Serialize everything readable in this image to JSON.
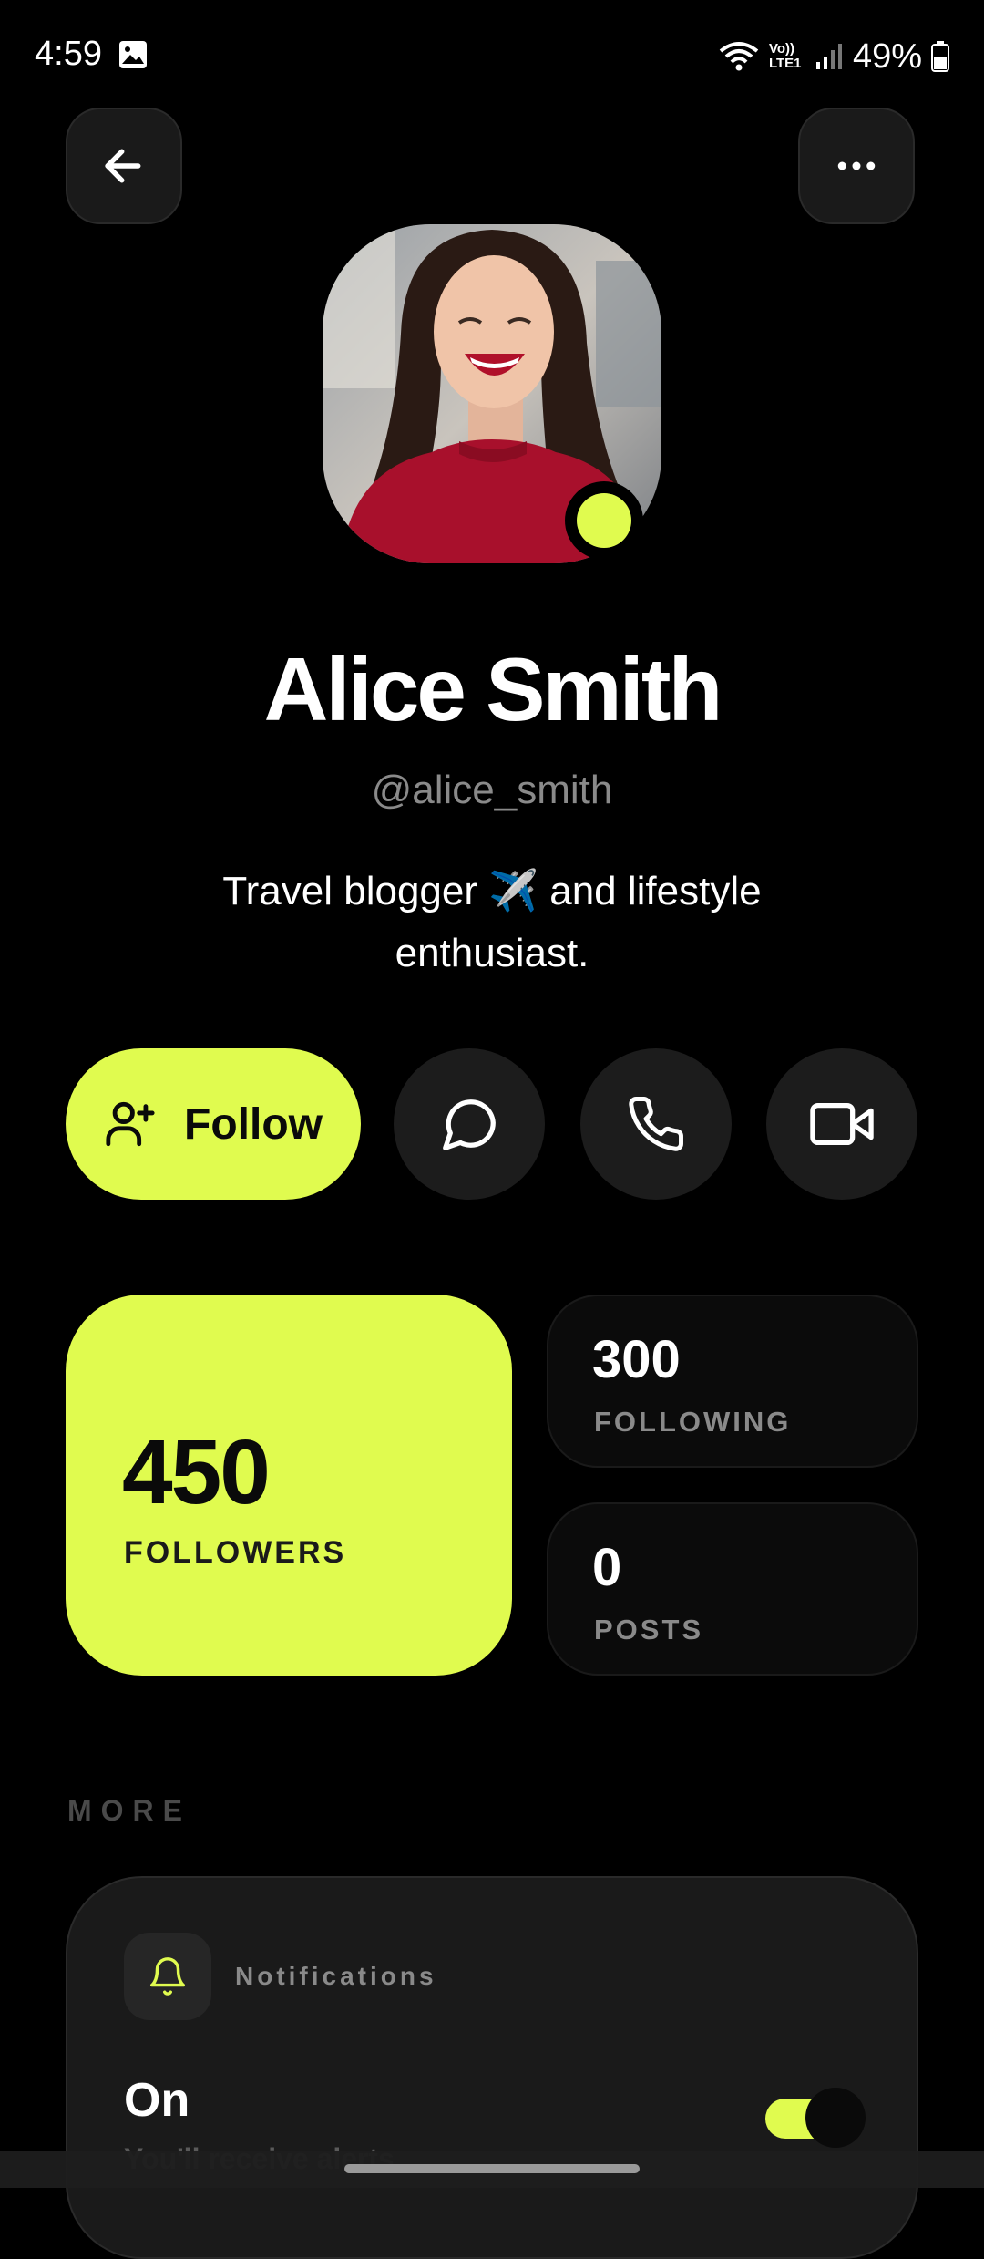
{
  "status_bar": {
    "time": "4:59",
    "battery": "49%",
    "network_label": "Vo)) LTE1"
  },
  "header": {
    "back_icon": "arrow-left-icon",
    "more_icon": "more-horizontal-icon"
  },
  "profile": {
    "name": "Alice Smith",
    "handle": "@alice_smith",
    "bio": "Travel blogger ✈️ and lifestyle enthusiast.",
    "online": true
  },
  "actions": {
    "follow_label": "Follow",
    "follow_icon": "user-plus-icon",
    "message_icon": "message-circle-icon",
    "call_icon": "phone-icon",
    "video_icon": "video-icon"
  },
  "stats": {
    "followers": {
      "count": "450",
      "label": "FOLLOWERS"
    },
    "following": {
      "count": "300",
      "label": "FOLLOWING"
    },
    "posts": {
      "count": "0",
      "label": "POSTS"
    }
  },
  "more": {
    "heading": "MORE",
    "notifications": {
      "title": "Notifications",
      "state": "On",
      "description": "You'll receive alerts",
      "enabled": true,
      "icon": "bell-icon"
    }
  },
  "colors": {
    "accent": "#e0fb4f",
    "background": "#000000",
    "card": "#1a1a1a",
    "muted_text": "#8a8a8a"
  }
}
